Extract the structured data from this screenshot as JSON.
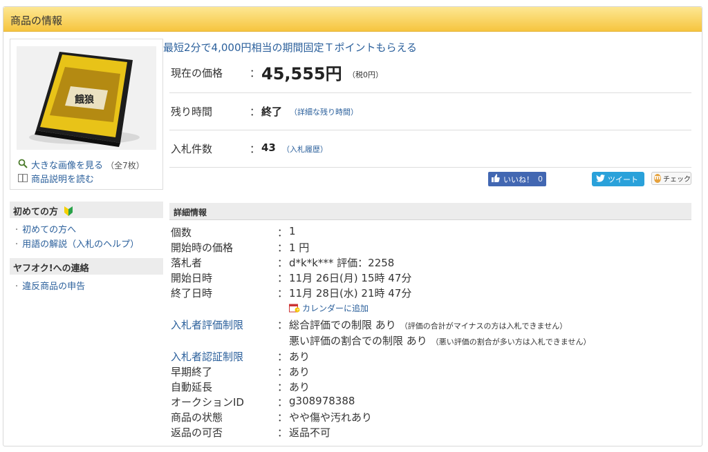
{
  "panel": {
    "title": "商品の情報"
  },
  "image_links": {
    "large_image": "大きな画像を見る",
    "large_image_count": "（全7枚）",
    "description": "商品説明を読む"
  },
  "promo": "最短2分で4,000円相当の期間固定Ｔポイントもらえる",
  "price": {
    "label": "現在の価格",
    "colon": "：",
    "value": "45,555円",
    "tax": "（税0円）"
  },
  "remaining": {
    "label": "残り時間",
    "colon": "：",
    "value": "終了",
    "link": "（詳細な残り時間）"
  },
  "bids": {
    "label": "入札件数",
    "colon": "：",
    "value": "43",
    "link": "（入札履歴）"
  },
  "social": {
    "like": "いいね！",
    "like_count": "0",
    "tweet": "ツイート",
    "check": "チェック"
  },
  "sidebar": {
    "section1_title": "初めての方",
    "section1_items": [
      "初めての方へ",
      "用語の解説（入札のヘルプ）"
    ],
    "section2_title": "ヤフオク!への連絡",
    "section2_items": [
      "違反商品の申告"
    ]
  },
  "details": {
    "title": "詳細情報",
    "colon": "：",
    "rows": [
      {
        "label": "個数",
        "value": "1"
      },
      {
        "label": "開始時の価格",
        "value": "1 円"
      },
      {
        "label": "落札者",
        "value": "d*k*k*** 評価：2258"
      },
      {
        "label": "開始日時",
        "value": "11月 26日(月) 15時 47分"
      },
      {
        "label": "終了日時",
        "value": "11月 28日(水) 21時 47分"
      },
      {
        "label": "入札者評価制限",
        "value": "総合評価での制限 あり",
        "note": "（評価の合計がマイナスの方は入札できません）",
        "value2": "悪い評価の割合での制限 あり",
        "note2": "（悪い評価の割合が多い方は入札できません）"
      },
      {
        "label": "入札者認証制限",
        "value": "あり"
      },
      {
        "label": "早期終了",
        "value": "あり"
      },
      {
        "label": "自動延長",
        "value": "あり"
      },
      {
        "label": "オークションID",
        "value": "g308978388"
      },
      {
        "label": "商品の状態",
        "value": "やや傷や汚れあり"
      },
      {
        "label": "返品の可否",
        "value": "返品不可"
      }
    ],
    "calendar_link": "カレンダーに追加"
  }
}
